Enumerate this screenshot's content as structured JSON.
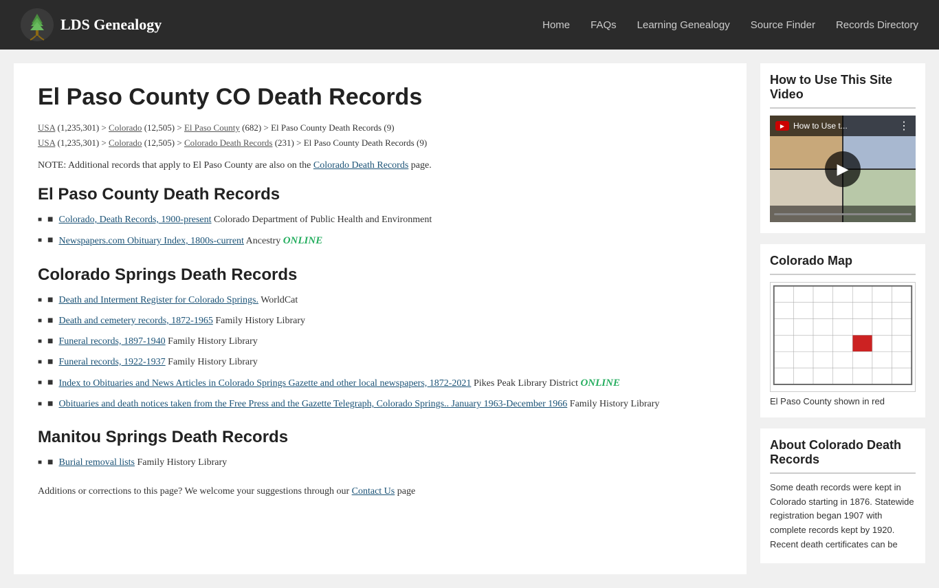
{
  "header": {
    "logo_text": "LDS Genealogy",
    "nav_items": [
      {
        "label": "Home",
        "href": "#"
      },
      {
        "label": "FAQs",
        "href": "#"
      },
      {
        "label": "Learning Genealogy",
        "href": "#"
      },
      {
        "label": "Source Finder",
        "href": "#"
      },
      {
        "label": "Records Directory",
        "href": "#"
      }
    ]
  },
  "main": {
    "page_title": "El Paso County CO Death Records",
    "breadcrumb1": "USA (1,235,301) > Colorado (12,505) > El Paso County (682) > El Paso County Death Records (9)",
    "breadcrumb2": "USA (1,235,301) > Colorado (12,505) > Colorado Death Records (231) > El Paso County Death Records (9)",
    "breadcrumb_usa1": "USA",
    "breadcrumb_colorado1": "Colorado",
    "breadcrumb_elpaso1": "El Paso County",
    "breadcrumb_usa2": "USA",
    "breadcrumb_colorado2": "Colorado",
    "breadcrumb_coloradodeath": "Colorado Death Records",
    "note": "NOTE: Additional records that apply to El Paso County are also on the",
    "note_link": "Colorado Death Records",
    "note_suffix": "page.",
    "section1_title": "El Paso County Death Records",
    "section1_items": [
      {
        "link": "Colorado, Death Records, 1900-present",
        "suffix": "Colorado Department of Public Health and Environment",
        "online": false
      },
      {
        "link": "Newspapers.com Obituary Index, 1800s-current",
        "prefix": "",
        "suffix": "Ancestry",
        "online": true
      }
    ],
    "section2_title": "Colorado Springs Death Records",
    "section2_items": [
      {
        "link": "Death and Interment Register for Colorado Springs.",
        "suffix": "WorldCat",
        "online": false
      },
      {
        "link": "Death and cemetery records, 1872-1965",
        "suffix": "Family History Library",
        "online": false
      },
      {
        "link": "Funeral records, 1897-1940",
        "suffix": "Family History Library",
        "online": false
      },
      {
        "link": "Funeral records, 1922-1937",
        "suffix": "Family History Library",
        "online": false
      },
      {
        "link": "Index to Obituaries and News Articles in Colorado Springs Gazette and other local newspapers, 1872-2021",
        "suffix": "Pikes Peak Library District",
        "online": true
      },
      {
        "link": "Obituaries and death notices taken from the Free Press and the Gazette Telegraph, Colorado Springs.. January 1963-December 1966",
        "suffix": "Family History Library",
        "online": false
      }
    ],
    "section3_title": "Manitou Springs Death Records",
    "section3_items": [
      {
        "link": "Burial removal lists",
        "suffix": "Family History Library",
        "online": false
      }
    ],
    "footer_note": "Additions or corrections to this page? We welcome your suggestions through our",
    "footer_link": "Contact Us",
    "footer_suffix": "page"
  },
  "sidebar": {
    "video_section_title": "How to Use This Site Video",
    "video_title": "How to Use t...",
    "map_section_title": "Colorado Map",
    "map_caption": "El Paso County shown in red",
    "about_section_title": "About Colorado Death Records",
    "about_text": "Some death records were kept in Colorado starting in 1876. Statewide registration began 1907 with complete records kept by 1920. Recent death certificates can be"
  }
}
